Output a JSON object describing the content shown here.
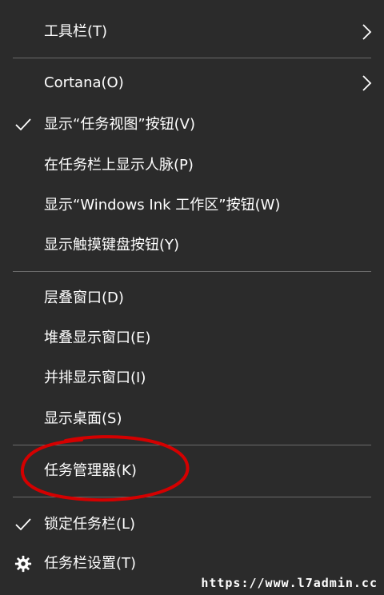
{
  "menu": {
    "items": [
      {
        "label": "工具栏(T)"
      },
      {
        "label": "Cortana(O)"
      },
      {
        "label": "显示“任务视图”按钮(V)"
      },
      {
        "label": "在任务栏上显示人脉(P)"
      },
      {
        "label": "显示“Windows Ink 工作区”按钮(W)"
      },
      {
        "label": "显示触摸键盘按钮(Y)"
      },
      {
        "label": "层叠窗口(D)"
      },
      {
        "label": "堆叠显示窗口(E)"
      },
      {
        "label": "并排显示窗口(I)"
      },
      {
        "label": "显示桌面(S)"
      },
      {
        "label": "任务管理器(K)"
      },
      {
        "label": "锁定任务栏(L)"
      },
      {
        "label": "任务栏设置(T)"
      }
    ]
  },
  "icons": {
    "submenu": "chevron-right-icon",
    "checked": "checkmark-icon",
    "settings": "gear-icon"
  },
  "colors": {
    "menu_background": "#2b2b2b",
    "text": "#ffffff",
    "separator": "#6a6a6a",
    "annotation": "#d40000"
  },
  "watermark": "https://www.l7admin.cc"
}
